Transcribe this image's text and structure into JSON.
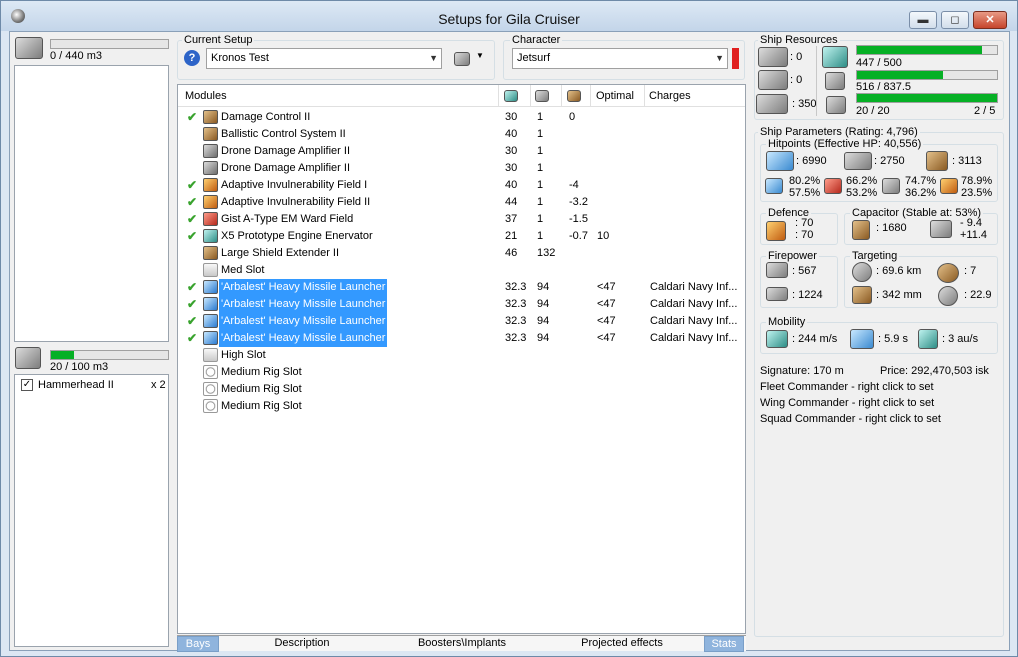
{
  "window": {
    "title": "Setups for Gila Cruiser",
    "min_label": "▬",
    "max_label": "◻",
    "close_label": "✕"
  },
  "left": {
    "cargo": {
      "value": "0 / 440 m3",
      "progress": 0
    },
    "drone_bay": {
      "value": "20 / 100 m3",
      "progress": 0.2
    },
    "drones": [
      {
        "checked": true,
        "name": "Hammerhead II",
        "qty": "x 2"
      }
    ]
  },
  "setup": {
    "group_label": "Current Setup",
    "value": "Kronos Test"
  },
  "character": {
    "group_label": "Character",
    "value": "Jetsurf",
    "status_color": "#e02020"
  },
  "modules": {
    "headers": {
      "name": "Modules",
      "optimal": "Optimal",
      "charges": "Charges"
    },
    "rows": [
      {
        "check": "✔",
        "name": "Damage Control II",
        "c1": "30",
        "c2": "1",
        "c3": "0",
        "optimal": "",
        "charges": "",
        "icon": "brown",
        "selected": false
      },
      {
        "check": "",
        "name": "Ballistic Control System II",
        "c1": "40",
        "c2": "1",
        "c3": "",
        "optimal": "",
        "charges": "",
        "icon": "brown",
        "selected": false
      },
      {
        "check": "",
        "name": "Drone Damage Amplifier II",
        "c1": "30",
        "c2": "1",
        "c3": "",
        "optimal": "",
        "charges": "",
        "icon": "grey",
        "selected": false
      },
      {
        "check": "",
        "name": "Drone Damage Amplifier II",
        "c1": "30",
        "c2": "1",
        "c3": "",
        "optimal": "",
        "charges": "",
        "icon": "grey",
        "selected": false
      },
      {
        "check": "✔",
        "name": "Adaptive Invulnerability Field I",
        "c1": "40",
        "c2": "1",
        "c3": "-4",
        "optimal": "",
        "charges": "",
        "icon": "orange",
        "selected": false
      },
      {
        "check": "✔",
        "name": "Adaptive Invulnerability Field II",
        "c1": "44",
        "c2": "1",
        "c3": "-3.2",
        "optimal": "",
        "charges": "",
        "icon": "orange",
        "selected": false
      },
      {
        "check": "✔",
        "name": "Gist A-Type EM Ward Field",
        "c1": "37",
        "c2": "1",
        "c3": "-1.5",
        "optimal": "",
        "charges": "",
        "icon": "red",
        "selected": false
      },
      {
        "check": "✔",
        "name": "X5 Prototype Engine Enervator",
        "c1": "21",
        "c2": "1",
        "c3": "-0.7",
        "optimal": "10",
        "charges": "",
        "icon": "teal",
        "selected": false
      },
      {
        "check": "",
        "name": "Large Shield Extender II",
        "c1": "46",
        "c2": "132",
        "c3": "",
        "optimal": "",
        "charges": "",
        "icon": "brown",
        "selected": false
      },
      {
        "check": "",
        "name": "Med Slot",
        "c1": "",
        "c2": "",
        "c3": "",
        "optimal": "",
        "charges": "",
        "icon": "slot",
        "selected": false
      },
      {
        "check": "✔",
        "name": "'Arbalest' Heavy Missile Launcher",
        "c1": "32.3",
        "c2": "94",
        "c3": "",
        "optimal": "<47",
        "charges": "Caldari Navy Inf...",
        "icon": "blue",
        "selected": true
      },
      {
        "check": "✔",
        "name": "'Arbalest' Heavy Missile Launcher",
        "c1": "32.3",
        "c2": "94",
        "c3": "",
        "optimal": "<47",
        "charges": "Caldari Navy Inf...",
        "icon": "blue",
        "selected": true
      },
      {
        "check": "✔",
        "name": "'Arbalest' Heavy Missile Launcher",
        "c1": "32.3",
        "c2": "94",
        "c3": "",
        "optimal": "<47",
        "charges": "Caldari Navy Inf...",
        "icon": "blue",
        "selected": true
      },
      {
        "check": "✔",
        "name": "'Arbalest' Heavy Missile Launcher",
        "c1": "32.3",
        "c2": "94",
        "c3": "",
        "optimal": "<47",
        "charges": "Caldari Navy Inf...",
        "icon": "blue",
        "selected": true
      },
      {
        "check": "",
        "name": "High Slot",
        "c1": "",
        "c2": "",
        "c3": "",
        "optimal": "",
        "charges": "",
        "icon": "slot",
        "selected": false
      },
      {
        "check": "",
        "name": "Medium Rig Slot",
        "c1": "",
        "c2": "",
        "c3": "",
        "optimal": "",
        "charges": "",
        "icon": "rig",
        "selected": false
      },
      {
        "check": "",
        "name": "Medium Rig Slot",
        "c1": "",
        "c2": "",
        "c3": "",
        "optimal": "",
        "charges": "",
        "icon": "rig",
        "selected": false
      },
      {
        "check": "",
        "name": "Medium Rig Slot",
        "c1": "",
        "c2": "",
        "c3": "",
        "optimal": "",
        "charges": "",
        "icon": "rig",
        "selected": false
      }
    ]
  },
  "tabs": {
    "bays": "Bays",
    "description": "Description",
    "boosters": "Boosters\\Implants",
    "projected": "Projected effects",
    "stats": "Stats"
  },
  "resources": {
    "label": "Ship Resources",
    "turrets": ": 0",
    "launchers": ": 0",
    "calibration": ": 350",
    "cpu": {
      "value": "447 / 500",
      "progress": 0.894
    },
    "powergrid": {
      "value": "516 / 837.5",
      "progress": 0.616
    },
    "drones": {
      "value": "20 / 20",
      "extra": "2 / 5",
      "progress": 1.0
    }
  },
  "params": {
    "label": "Ship Parameters (Rating: 4,796)",
    "hitpoints": {
      "label": "Hitpoints (Effective HP: 40,556)",
      "shield": ": 6990",
      "armor": ": 2750",
      "hull": ": 3113",
      "res": [
        "80.2%",
        "57.5%",
        "66.2%",
        "53.2%",
        "74.7%",
        "36.2%",
        "78.9%",
        "23.5%"
      ]
    },
    "defence": {
      "label": "Defence",
      "v1": ": 70",
      "v2": ": 70"
    },
    "capacitor": {
      "label": "Capacitor (Stable at: 53%)",
      "amount": ": 1680",
      "r1": "- 9.4",
      "r2": "+11.4"
    },
    "firepower": {
      "label": "Firepower",
      "v1": ": 567",
      "v2": ": 1224"
    },
    "targeting": {
      "label": "Targeting",
      "range": ": 69.6 km",
      "targets": ": 7",
      "res": ": 342 mm",
      "scan": ": 22.9"
    },
    "mobility": {
      "label": "Mobility",
      "speed": ": 244 m/s",
      "align": ": 5.9 s",
      "warp": ": 3 au/s"
    },
    "signature": "Signature: 170 m",
    "price": "Price: 292,470,503 isk",
    "fleet": "Fleet Commander - right click to set",
    "wing": "Wing Commander - right click to set",
    "squad": "Squad Commander - right click to set"
  }
}
